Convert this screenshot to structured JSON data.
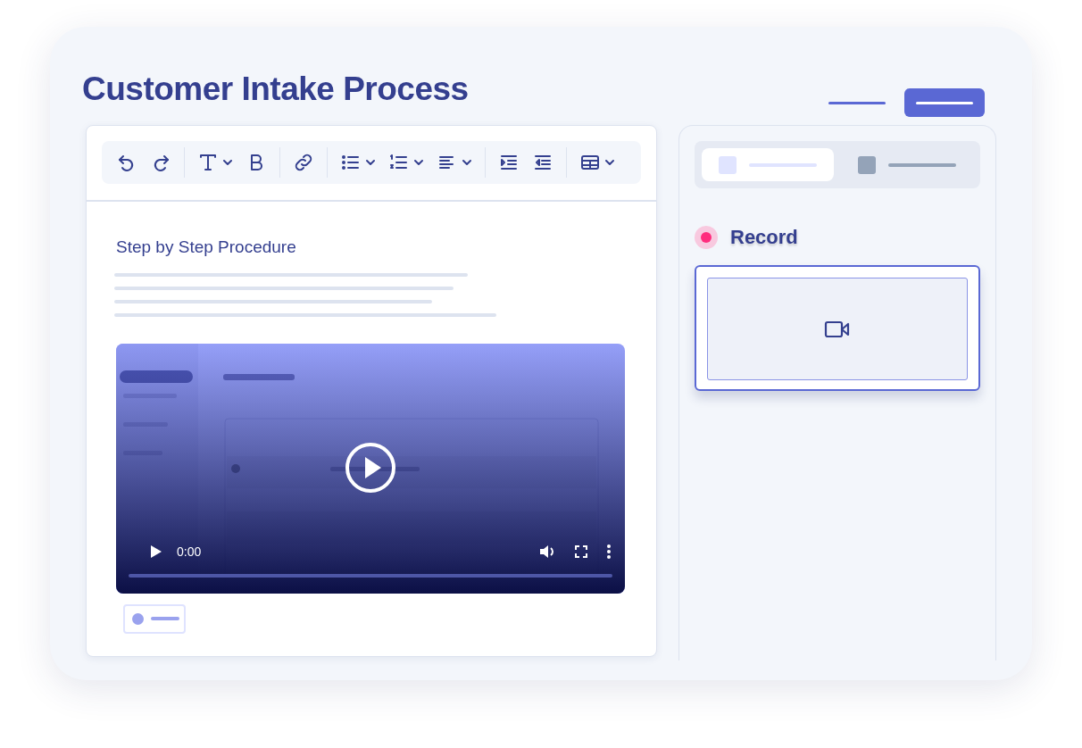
{
  "title": "Customer Intake Process",
  "editor": {
    "heading": "Step by Step Procedure",
    "video": {
      "kind": "picture",
      "time": "0:00"
    }
  },
  "panel": {
    "tabs": [
      {
        "selected": true
      },
      {
        "selected": false
      }
    ],
    "record": {
      "label": "Record"
    }
  }
}
